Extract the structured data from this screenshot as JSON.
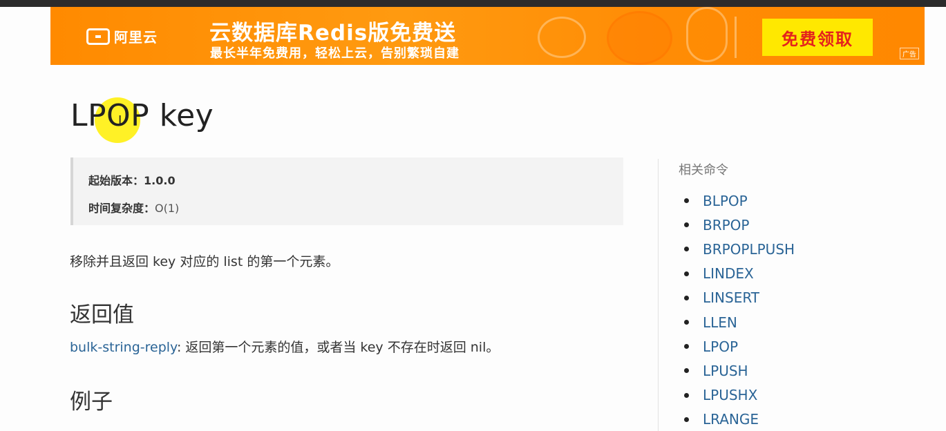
{
  "banner": {
    "logo_text": "阿里云",
    "title": "云数据库Redis版免费送",
    "subtitle": "最长半年免费用，轻松上云，告别繁琐自建",
    "cta_label": "免费领取",
    "ad_tag": "广告",
    "colors": {
      "background": "#ff8c00",
      "cta_bg": "#ffe800",
      "cta_text": "#e4221d"
    }
  },
  "page": {
    "title": "LPOP key",
    "info": {
      "since_label": "起始版本：",
      "since_value": "1.0.0",
      "complexity_label": "时间复杂度：",
      "complexity_value": "O(1)"
    },
    "description": "移除并且返回 key 对应的 list 的第一个元素。",
    "return_heading": "返回值",
    "return_link": "bulk-string-reply",
    "return_text": ": 返回第一个元素的值，或者当 key 不存在时返回 nil。",
    "example_heading": "例子"
  },
  "sidebar": {
    "title": "相关命令",
    "items": [
      "BLPOP",
      "BRPOP",
      "BRPOPLPUSH",
      "LINDEX",
      "LINSERT",
      "LLEN",
      "LPOP",
      "LPUSH",
      "LPUSHX",
      "LRANGE"
    ]
  },
  "colors": {
    "link": "#2a6496",
    "cursor_highlight": "#ffee00"
  }
}
